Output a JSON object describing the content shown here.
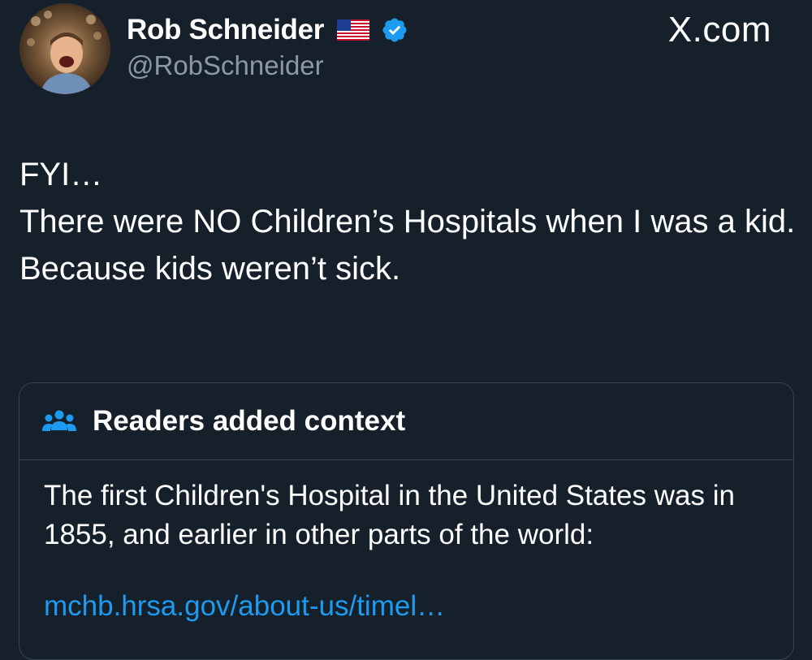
{
  "author": {
    "display_name": "Rob Schneider",
    "handle": "@RobSchneider",
    "avatar": "avatar-photo",
    "flag_icon": "us-flag-icon",
    "verified_icon": "verified-badge-icon"
  },
  "brand": "X.com",
  "tweet": {
    "lines": [
      "FYI…",
      "There were NO Children’s Hospitals when I was a kid.",
      "Because kids weren’t sick."
    ]
  },
  "context": {
    "title": "Readers added context",
    "icon": "people-icon",
    "body": "The first Children's Hospital in the United States was in 1855, and earlier in other parts of the world:",
    "link": "mchb.hrsa.gov/about-us/timel…"
  },
  "colors": {
    "background": "#15202b",
    "text": "#ffffff",
    "secondary": "#8b98a5",
    "link": "#1d9bf0",
    "border": "#38444d",
    "verified": "#1d9bf0"
  }
}
